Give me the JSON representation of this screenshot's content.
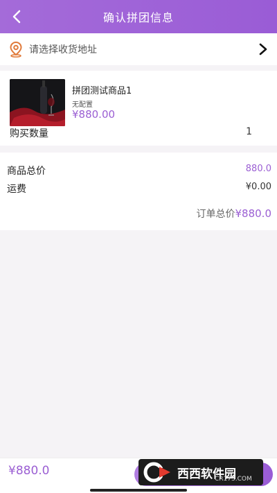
{
  "header": {
    "title": "确认拼团信息"
  },
  "address": {
    "placeholder": "请选择收货地址"
  },
  "product": {
    "name": "拼团测试商品1",
    "spec": "无配置",
    "price": "¥880.00",
    "qty_label": "购买数量",
    "qty_value": "1"
  },
  "summary": {
    "goods_total_label": "商品总价",
    "goods_total_value": "880.0",
    "shipping_label": "运费",
    "shipping_value": "¥0.00",
    "order_total_label": "订单总价",
    "order_total_value": "¥880.0"
  },
  "bottom": {
    "total": "¥880.0"
  },
  "watermark": {
    "brand": "西西软件园",
    "url": "CR173.COM"
  },
  "colors": {
    "accent": "#9b5fd3",
    "header": "#a46bd9"
  }
}
